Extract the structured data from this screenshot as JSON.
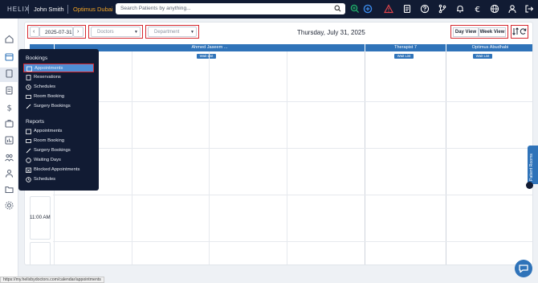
{
  "topbar": {
    "brand": "HELIX",
    "user_name": "John Smith",
    "branch": "Optimus Dubai",
    "search_placeholder": "Search Patients by anything..."
  },
  "toolbar": {
    "prev_label": "‹",
    "date": "2025-07-31",
    "next_label": "›",
    "doctors_label": "Doctors",
    "department_label": "Department",
    "heading": "Thursday, July 31, 2025",
    "day_view_label": "Day View",
    "week_view_label": "Week View"
  },
  "columns": [
    {
      "name": "Ahmed Jaseem ...",
      "waitlist": "Wait List"
    },
    {
      "name": "Therapist 7",
      "waitlist": "Wait List"
    },
    {
      "name": "Optimus Abudhabi",
      "waitlist": "Wait List"
    }
  ],
  "time_label": "11:00 AM",
  "menu": {
    "bookings_title": "Bookings",
    "bookings": [
      {
        "label": "Appointments",
        "icon": "calendar-icon",
        "active": true
      },
      {
        "label": "Reservations",
        "icon": "note-icon"
      },
      {
        "label": "Schedules",
        "icon": "clock-icon"
      },
      {
        "label": "Room Booking",
        "icon": "bed-icon"
      },
      {
        "label": "Surgery Bookings",
        "icon": "scalpel-icon"
      }
    ],
    "reports_title": "Reports",
    "reports": [
      {
        "label": "Appointments",
        "icon": "calendar-icon"
      },
      {
        "label": "Room Booking",
        "icon": "bed-icon"
      },
      {
        "label": "Surgery Bookings",
        "icon": "scalpel-icon"
      },
      {
        "label": "Waiting Days",
        "icon": "clock-icon"
      },
      {
        "label": "Blocked Appointments",
        "icon": "calendar-x-icon"
      },
      {
        "label": "Schedules",
        "icon": "clock-icon"
      }
    ]
  },
  "side_tab_label": "Patient Rooms",
  "status_url": "https://my.helixbydoctors.com/calendar/appointments",
  "colors": {
    "topbar": "#111b33",
    "accent": "#2f73b9",
    "highlight": "#d6282f",
    "branch": "#f5a524"
  }
}
